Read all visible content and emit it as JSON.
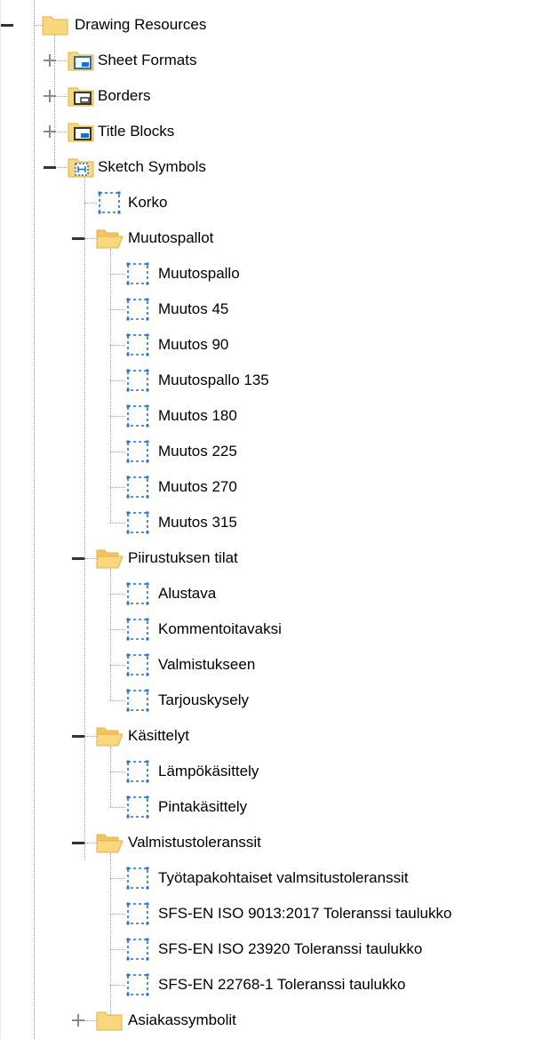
{
  "tree": {
    "root": {
      "label": "Drawing Resources",
      "icon": "folder-icon"
    },
    "sheet_formats": {
      "label": "Sheet Formats",
      "icon": "sheet-format-folder-icon"
    },
    "borders": {
      "label": "Borders",
      "icon": "border-folder-icon"
    },
    "title_blocks": {
      "label": "Title Blocks",
      "icon": "title-block-folder-icon"
    },
    "sketch_symbols": {
      "label": "Sketch Symbols",
      "icon": "sketch-symbol-folder-icon"
    },
    "korko": {
      "label": "Korko",
      "icon": "sketch-symbol-icon"
    },
    "muutospallot": {
      "label": "Muutospallot",
      "icon": "open-folder-icon",
      "items": [
        "Muutospallo",
        "Muutos 45",
        "Muutos 90",
        "Muutospallo 135",
        "Muutos 180",
        "Muutos 225",
        "Muutos 270",
        "Muutos 315"
      ]
    },
    "piirustuksen_tilat": {
      "label": "Piirustuksen tilat",
      "icon": "open-folder-icon",
      "items": [
        "Alustava",
        "Kommentoitavaksi",
        "Valmistukseen",
        "Tarjouskysely"
      ]
    },
    "kasittelyt": {
      "label": "Käsittelyt",
      "icon": "open-folder-icon",
      "items": [
        "Lämpökäsittely",
        "Pintakäsittely"
      ]
    },
    "valmistustoleranssit": {
      "label": "Valmistustoleranssit",
      "icon": "open-folder-icon",
      "items": [
        "Työtapakohtaiset valmsitustoleranssit",
        "SFS-EN ISO 9013:2017 Toleranssi taulukko",
        "SFS-EN ISO 23920 Toleranssi taulukko",
        "SFS-EN 22768-1 Toleranssi taulukko"
      ]
    },
    "asiakassymbolit": {
      "label": "Asiakassymbolit",
      "icon": "folder-icon"
    }
  },
  "colors": {
    "folder": "#f9d77e",
    "folder_border": "#e0b24a",
    "symbol_blue": "#1f6fd1",
    "connector": "#9a9a9a"
  }
}
